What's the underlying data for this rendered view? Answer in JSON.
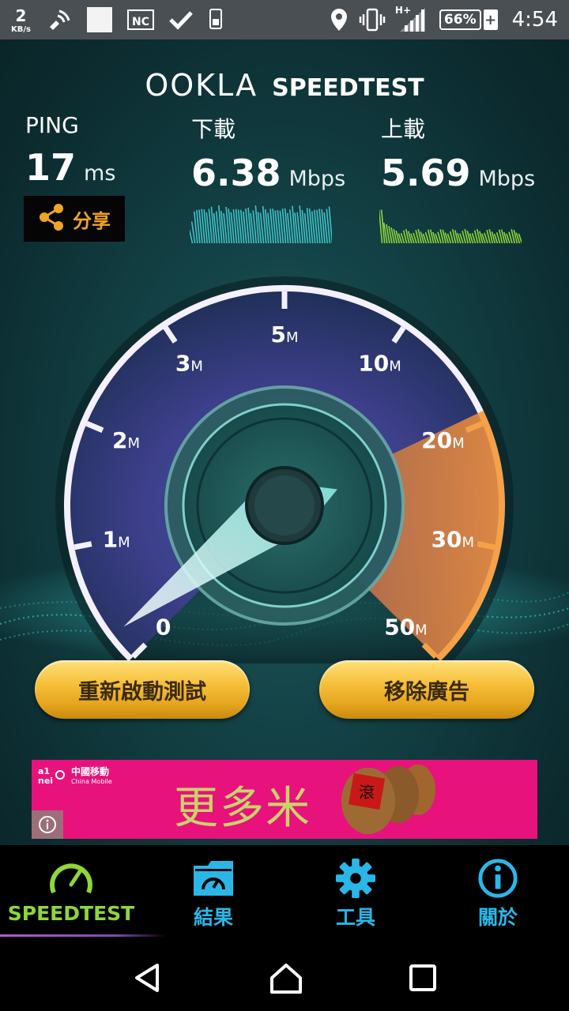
{
  "status_bar": {
    "speed_value": "2",
    "speed_unit": "KB/s",
    "network_type": "H+",
    "battery": "66%",
    "battery_plus": "+",
    "time": "4:54"
  },
  "header": {
    "logo_ookla": "OOKLA",
    "logo_speedtest": "SPEEDTEST"
  },
  "metrics": {
    "ping": {
      "label": "PING",
      "value": "17",
      "unit": "ms"
    },
    "download": {
      "label": "下載",
      "value": "6.38",
      "unit": "Mbps"
    },
    "upload": {
      "label": "上載",
      "value": "5.69",
      "unit": "Mbps"
    }
  },
  "share": {
    "label": "分享"
  },
  "gauge": {
    "ticks": [
      {
        "num": "0",
        "unit": ""
      },
      {
        "num": "1",
        "unit": "M"
      },
      {
        "num": "2",
        "unit": "M"
      },
      {
        "num": "3",
        "unit": "M"
      },
      {
        "num": "5",
        "unit": "M"
      },
      {
        "num": "10",
        "unit": "M"
      },
      {
        "num": "20",
        "unit": "M"
      },
      {
        "num": "30",
        "unit": "M"
      },
      {
        "num": "50",
        "unit": "M"
      }
    ],
    "needle_value": "0"
  },
  "buttons": {
    "restart": "重新啟動測試",
    "remove_ads": "移除廣告"
  },
  "ad": {
    "text": "更多米",
    "brand_cn": "中國移動",
    "brand_en": "China Mobile"
  },
  "tabs": [
    {
      "label": "SPEEDTEST",
      "icon": "speedometer-icon",
      "active": true
    },
    {
      "label": "結果",
      "icon": "results-folder-icon",
      "active": false
    },
    {
      "label": "工具",
      "icon": "gear-icon",
      "active": false
    },
    {
      "label": "關於",
      "icon": "info-icon",
      "active": false
    }
  ],
  "colors": {
    "download_graph": "#3fc3c8",
    "upload_graph": "#8ed63a",
    "active_tab": "#8ed63a",
    "tab": "#2ab7e8",
    "button": "#f6c03a",
    "ad_bg": "#e8127c"
  }
}
